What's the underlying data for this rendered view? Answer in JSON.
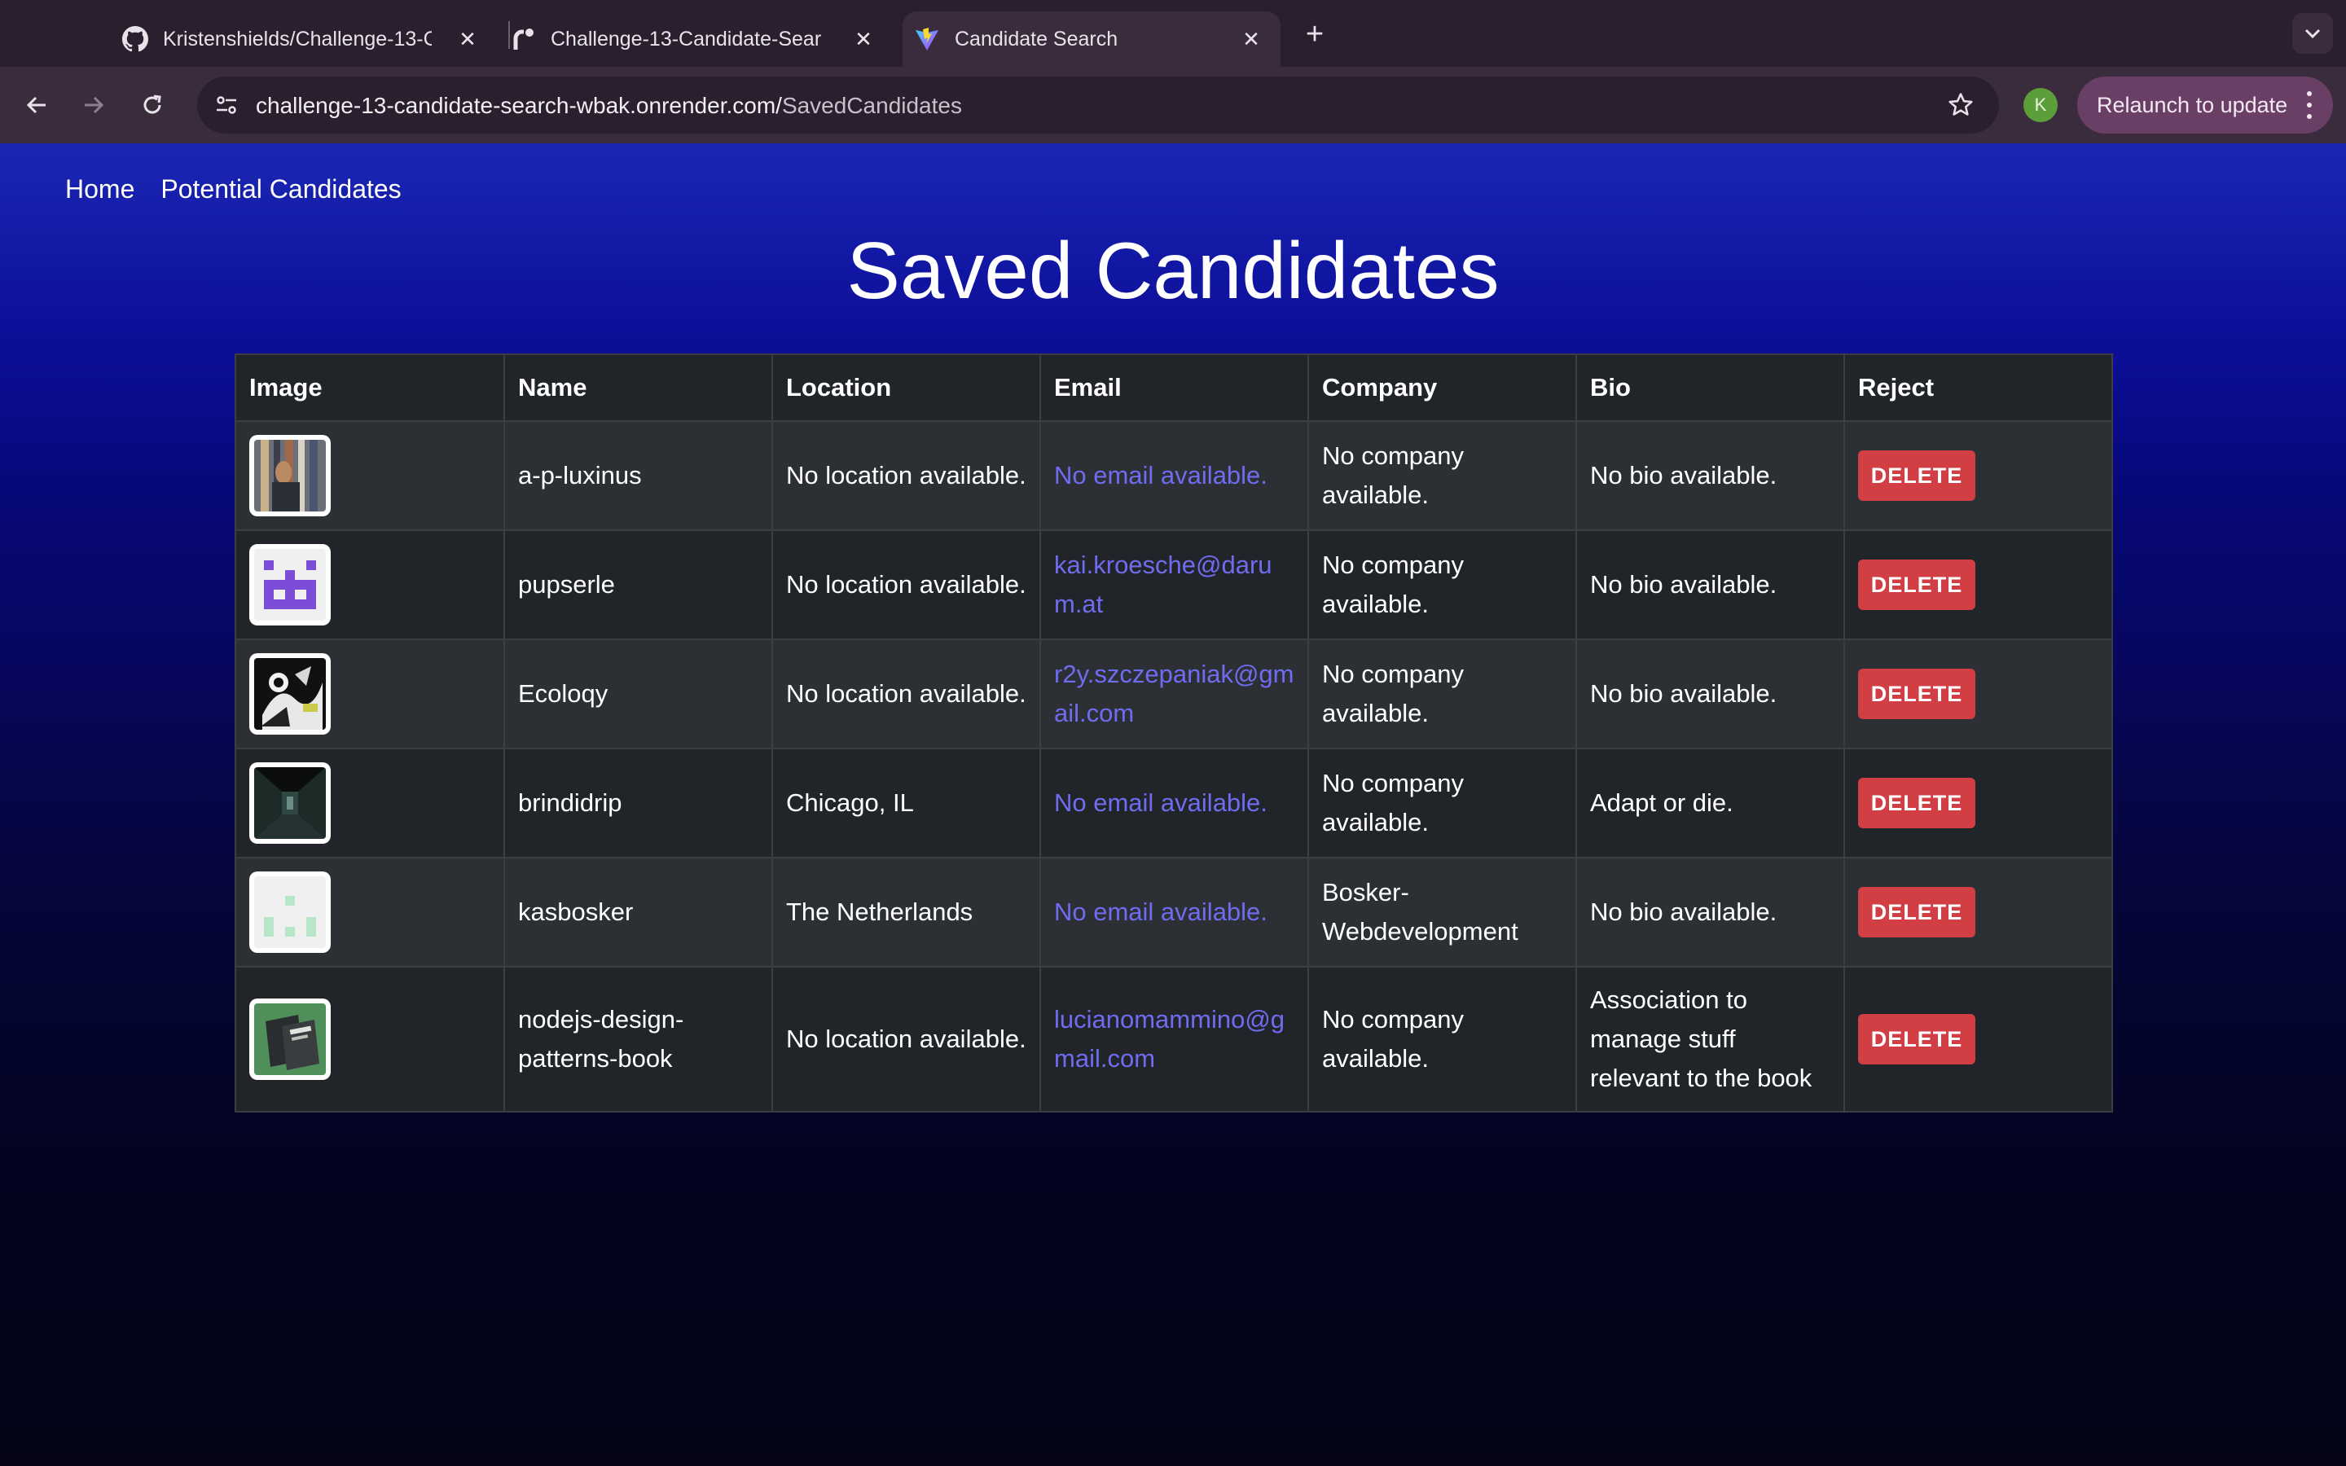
{
  "browser": {
    "tabs": [
      {
        "title": "Kristenshields/Challenge-13-C",
        "icon": "github-icon"
      },
      {
        "title": "Challenge-13-Candidate-Sear",
        "icon": "render-icon"
      },
      {
        "title": "Candidate Search",
        "icon": "vite-icon",
        "active": true
      }
    ],
    "url_host": "challenge-13-candidate-search-wbak.onrender.com/",
    "url_path": "SavedCandidates",
    "profile_initial": "K",
    "relaunch_label": "Relaunch to update"
  },
  "nav": {
    "home": "Home",
    "potential": "Potential Candidates"
  },
  "page": {
    "title": "Saved Candidates"
  },
  "table": {
    "headers": [
      "Image",
      "Name",
      "Location",
      "Email",
      "Company",
      "Bio",
      "Reject"
    ],
    "rows": [
      {
        "avatar": "photo-avatar-1",
        "name": "a-p-luxinus",
        "location": "No location available.",
        "email": "No email available.",
        "company": "No company available.",
        "bio": "No bio available.",
        "action": "DELETE"
      },
      {
        "avatar": "identicon-purple",
        "name": "pupserle",
        "location": "No location available.",
        "email": "kai.kroesche@darum.at",
        "company": "No company available.",
        "bio": "No bio available.",
        "action": "DELETE"
      },
      {
        "avatar": "photo-avatar-3",
        "name": "Ecoloqy",
        "location": "No location available.",
        "email": "r2y.szczepaniak@gmail.com",
        "company": "No company available.",
        "bio": "No bio available.",
        "action": "DELETE"
      },
      {
        "avatar": "photo-avatar-4",
        "name": "brindidrip",
        "location": "Chicago, IL",
        "email": "No email available.",
        "company": "No company available.",
        "bio": "Adapt or die.",
        "action": "DELETE"
      },
      {
        "avatar": "identicon-green",
        "name": "kasbosker",
        "location": "The Netherlands",
        "email": "No email available.",
        "company": "Bosker-Webdevelopment",
        "bio": "No bio available.",
        "action": "DELETE"
      },
      {
        "avatar": "book-avatar",
        "name": "nodejs-design-patterns-book",
        "location": "No location available.",
        "email": "lucianomammino@gmail.com",
        "company": "No company available.",
        "bio": "Association to manage stuff relevant to the book",
        "action": "DELETE"
      }
    ]
  },
  "colors": {
    "link": "#6f6cf0",
    "delete": "#d13f45",
    "table_dark": "#212529",
    "table_light": "#2c3034"
  }
}
